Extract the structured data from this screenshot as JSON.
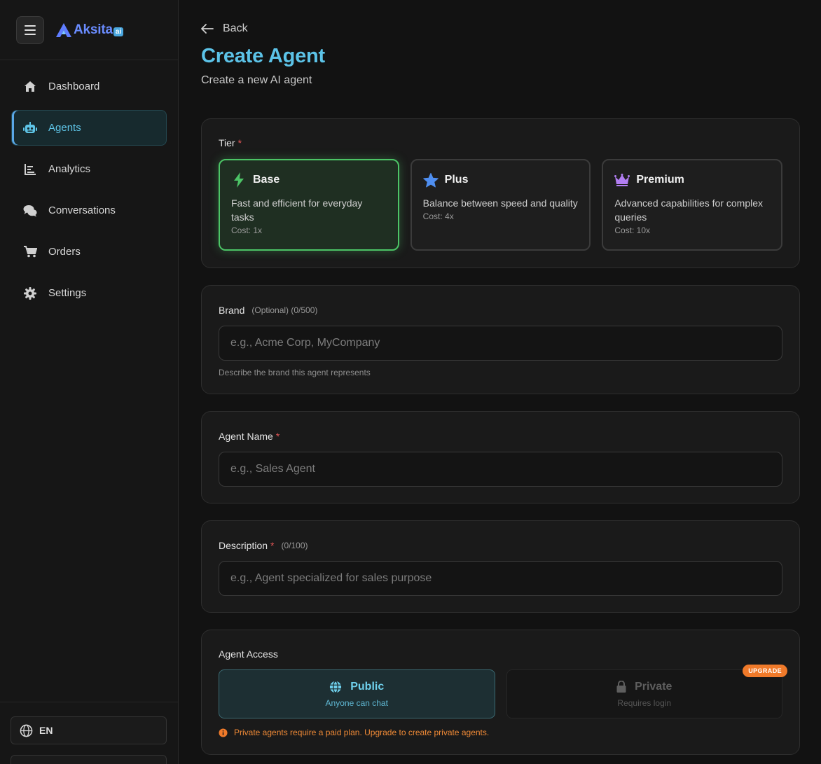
{
  "brand": {
    "name": "Aksita",
    "badge": "ai"
  },
  "nav": {
    "items": [
      {
        "label": "Dashboard",
        "icon": "home-icon"
      },
      {
        "label": "Agents",
        "icon": "robot-icon",
        "active": true
      },
      {
        "label": "Analytics",
        "icon": "bar-chart-icon"
      },
      {
        "label": "Conversations",
        "icon": "chat-bubbles-icon"
      },
      {
        "label": "Orders",
        "icon": "cart-icon"
      },
      {
        "label": "Settings",
        "icon": "gear-icon"
      }
    ]
  },
  "language": {
    "current": "EN"
  },
  "page": {
    "back_label": "Back",
    "title": "Create Agent",
    "subtitle": "Create a new AI agent"
  },
  "tier": {
    "label": "Tier",
    "required_mark": "*",
    "options": [
      {
        "name": "Base",
        "desc": "Fast and efficient for everyday tasks",
        "cost": "Cost: 1x",
        "selected": true,
        "icon": "bolt-icon"
      },
      {
        "name": "Plus",
        "desc": "Balance between speed and quality",
        "cost": "Cost: 4x",
        "icon": "star-icon"
      },
      {
        "name": "Premium",
        "desc": "Advanced capabilities for complex queries",
        "cost": "Cost: 10x",
        "icon": "crown-icon"
      }
    ]
  },
  "brand_field": {
    "label": "Brand",
    "hint": "(Optional) (0/500)",
    "placeholder": "e.g., Acme Corp, MyCompany",
    "helper": "Describe the brand this agent represents"
  },
  "name_field": {
    "label": "Agent Name",
    "required_mark": "*",
    "placeholder": "e.g., Sales Agent"
  },
  "description_field": {
    "label": "Description",
    "required_mark": "*",
    "hint": "(0/100)",
    "placeholder": "e.g., Agent specialized for sales purpose"
  },
  "access": {
    "label": "Agent Access",
    "public": {
      "title": "Public",
      "sub": "Anyone can chat"
    },
    "private": {
      "title": "Private",
      "sub": "Requires login",
      "badge": "UPGRADE"
    },
    "warning": "Private agents require a paid plan. Upgrade to create private agents."
  },
  "colors": {
    "accent": "#5cc3e8",
    "selected_tier": "#4cc466",
    "warning": "#f07a2a",
    "required": "#e05555"
  }
}
